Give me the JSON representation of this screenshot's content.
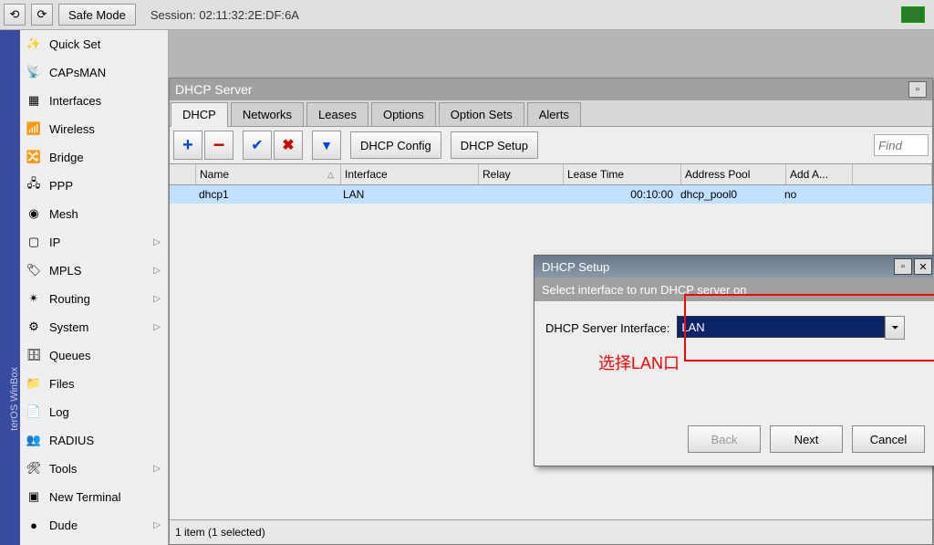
{
  "toolbar": {
    "safe_mode": "Safe Mode",
    "session_label": "Session:",
    "session_id": "02:11:32:2E:DF:6A"
  },
  "leftbar_text": "terOS  WinBox",
  "sidebar": {
    "items": [
      {
        "label": "Quick Set",
        "arrow": false
      },
      {
        "label": "CAPsMAN",
        "arrow": false
      },
      {
        "label": "Interfaces",
        "arrow": false
      },
      {
        "label": "Wireless",
        "arrow": false
      },
      {
        "label": "Bridge",
        "arrow": false
      },
      {
        "label": "PPP",
        "arrow": false
      },
      {
        "label": "Mesh",
        "arrow": false
      },
      {
        "label": "IP",
        "arrow": true
      },
      {
        "label": "MPLS",
        "arrow": true
      },
      {
        "label": "Routing",
        "arrow": true
      },
      {
        "label": "System",
        "arrow": true
      },
      {
        "label": "Queues",
        "arrow": false
      },
      {
        "label": "Files",
        "arrow": false
      },
      {
        "label": "Log",
        "arrow": false
      },
      {
        "label": "RADIUS",
        "arrow": false
      },
      {
        "label": "Tools",
        "arrow": true
      },
      {
        "label": "New Terminal",
        "arrow": false
      },
      {
        "label": "Dude",
        "arrow": true
      }
    ]
  },
  "dhcp_win": {
    "title": "DHCP Server",
    "tabs": [
      "DHCP",
      "Networks",
      "Leases",
      "Options",
      "Option Sets",
      "Alerts"
    ],
    "buttons": {
      "config": "DHCP Config",
      "setup": "DHCP Setup"
    },
    "find": "Find",
    "cols": [
      "Name",
      "Interface",
      "Relay",
      "Lease Time",
      "Address Pool",
      "Add A..."
    ],
    "widths": [
      150,
      142,
      84,
      120,
      106,
      64
    ],
    "row": {
      "name": "dhcp1",
      "interface": "LAN",
      "relay": "",
      "lease": "00:10:00",
      "pool": "dhcp_pool0",
      "adda": "no"
    },
    "status": "1 item (1 selected)"
  },
  "setup": {
    "title": "DHCP Setup",
    "subtitle": "Select interface to run DHCP server on",
    "field_label": "DHCP Server Interface:",
    "value": "LAN",
    "annotation": "选择LAN口",
    "back": "Back",
    "next": "Next",
    "cancel": "Cancel"
  }
}
